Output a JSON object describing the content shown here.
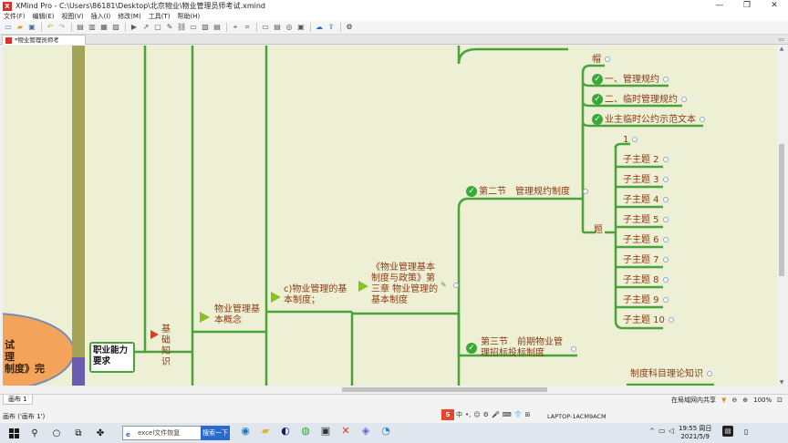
{
  "window": {
    "title": "XMind Pro - C:\\Users\\86181\\Desktop\\北京物业\\物业管理员师考试.xmind",
    "controls": [
      "—",
      "❐",
      "✕"
    ]
  },
  "menu": [
    "文件(F)",
    "编辑(E)",
    "视图(V)",
    "插入(I)",
    "修改(M)",
    "工具(T)",
    "帮助(H)"
  ],
  "tab": {
    "label": "*物业管理员师考试.xmind"
  },
  "mindmap": {
    "central": [
      "试",
      "理",
      "制度》完"
    ],
    "level1": "职业能力要求",
    "level2": "基础知识",
    "level3": "物业管理基本概念",
    "level4": "c)物业管理的基本制度；",
    "level5": "《物业管理基本制度与政策》第三章 物业管理的基本制度",
    "section2": "第二节　管理规约制度",
    "section3": "第三节　前期物业管理招标投标制度",
    "hat": "帽",
    "hat_children": [
      "一、管理规约",
      "二、临时管理规约",
      "业主临时公约示范文本"
    ],
    "ti": "题",
    "ti_first": "1",
    "subtopics": [
      "子主题 2",
      "子主题 3",
      "子主题 4",
      "子主题 5",
      "子主题 6",
      "子主题 7",
      "子主题 8",
      "子主题 9",
      "子主题 10"
    ],
    "bottom": "制度科目理论知识",
    "colors": {
      "line": "#4aa23a",
      "text": "#8b3a14",
      "bg": "#eef0d5",
      "central": "#f4a45a"
    }
  },
  "sheet": {
    "tab": "画布 1",
    "share": "在局域网内共享",
    "zoom": "100%"
  },
  "status": {
    "text": "画布 ('画布 1')",
    "computer": "LAPTOP-1ACM9ACM",
    "ime": [
      "中",
      "•,",
      "☺",
      "⚙",
      "🎤",
      "⌨",
      "👕",
      "⊞"
    ]
  },
  "taskbar": {
    "search_placeholder": "excel文件恢复",
    "search_button": "搜索一下",
    "time": "19:55 周日",
    "date": "2021/5/9"
  }
}
